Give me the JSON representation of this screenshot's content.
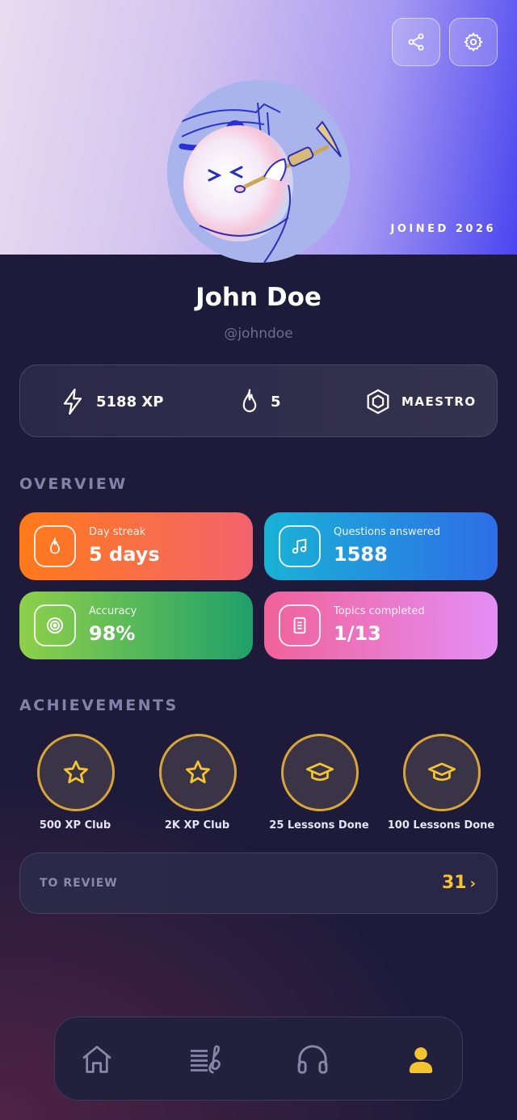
{
  "header": {
    "joined": "JOINED 2026",
    "share_icon": "share-icon",
    "settings_icon": "gear-icon"
  },
  "profile": {
    "name": "John Doe",
    "handle": "@johndoe",
    "avatar_icon": "trumpet-player-avatar"
  },
  "stats": {
    "xp": "5188 XP",
    "streak": "5",
    "rank": "MAESTRO"
  },
  "overview": {
    "title": "OVERVIEW",
    "cards": [
      {
        "label": "Day streak",
        "value": "5 days",
        "icon": "flame-icon"
      },
      {
        "label": "Questions answered",
        "value": "1588",
        "icon": "music-note-icon"
      },
      {
        "label": "Accuracy",
        "value": "98%",
        "icon": "target-icon"
      },
      {
        "label": "Topics completed",
        "value": "1/13",
        "icon": "document-icon"
      }
    ]
  },
  "achievements": {
    "title": "ACHIEVEMENTS",
    "items": [
      {
        "label": "500 XP Club",
        "icon": "star-icon"
      },
      {
        "label": "2K XP Club",
        "icon": "star-icon"
      },
      {
        "label": "25 Lessons Done",
        "icon": "graduation-cap-icon"
      },
      {
        "label": "100 Lessons Done",
        "icon": "graduation-cap-icon"
      }
    ]
  },
  "review": {
    "label": "TO REVIEW",
    "count": "31",
    "chevron": "›"
  },
  "nav": {
    "items": [
      {
        "name": "home",
        "icon": "home-icon"
      },
      {
        "name": "lessons",
        "icon": "sheet-music-icon"
      },
      {
        "name": "listening",
        "icon": "headphones-icon"
      },
      {
        "name": "profile",
        "icon": "user-icon",
        "active": true
      }
    ]
  },
  "colors": {
    "accent_gold": "#f3c430",
    "badge_ring": "#d7a53a",
    "background": "#1e1b3a"
  }
}
